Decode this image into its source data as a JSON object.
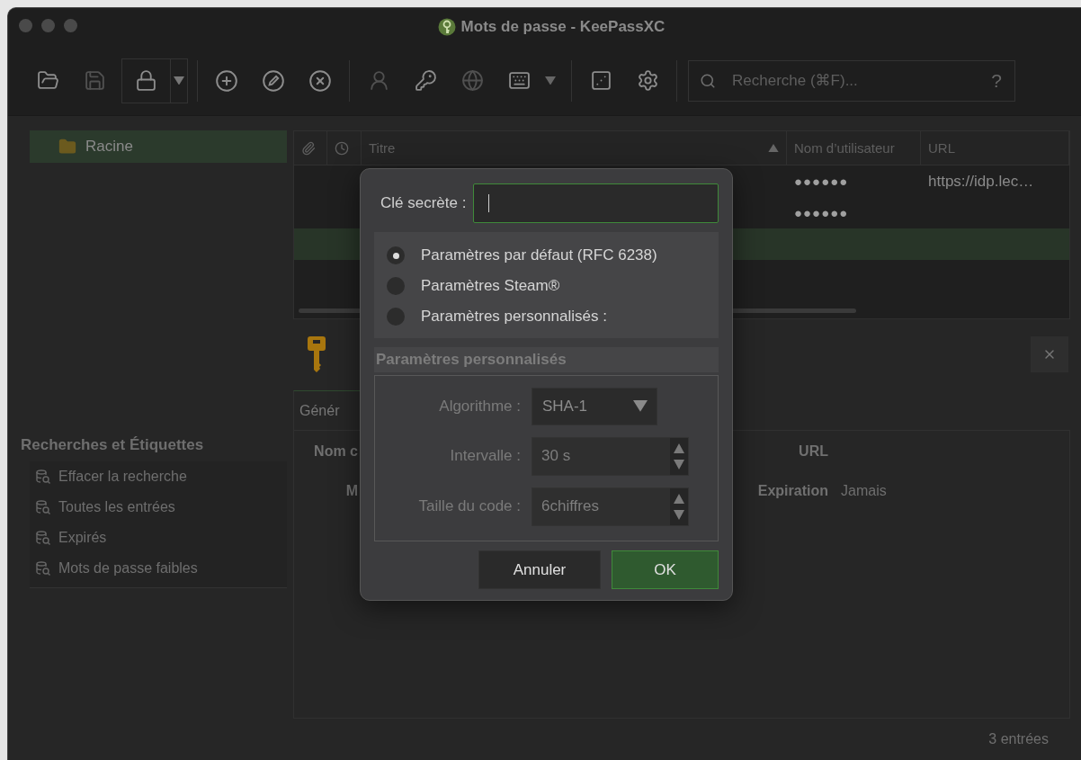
{
  "window": {
    "title": "Mots de passe - KeePassXC"
  },
  "toolbar": {
    "items": [
      {
        "kind": "open",
        "disabled": false
      },
      {
        "kind": "save",
        "disabled": true
      },
      {
        "kind": "lock",
        "disabled": false
      },
      {
        "kind": "separator"
      },
      {
        "kind": "add",
        "disabled": false
      },
      {
        "kind": "edit",
        "disabled": false
      },
      {
        "kind": "delete",
        "disabled": false
      },
      {
        "kind": "separator"
      },
      {
        "kind": "copy-user",
        "disabled": true
      },
      {
        "kind": "copy-password",
        "disabled": false
      },
      {
        "kind": "open-url",
        "disabled": true
      },
      {
        "kind": "autotype",
        "disabled": false
      },
      {
        "kind": "separator"
      },
      {
        "kind": "generator",
        "disabled": false
      },
      {
        "kind": "settings",
        "disabled": false
      },
      {
        "kind": "separator"
      }
    ],
    "search": {
      "placeholder": "Recherche (⌘F)..."
    },
    "help": "?"
  },
  "groups": [
    {
      "label": "Racine",
      "selected": true
    }
  ],
  "searches": {
    "title": "Recherches et Étiquettes",
    "items": [
      {
        "label": "Effacer la recherche"
      },
      {
        "label": "Toutes les entrées"
      },
      {
        "label": "Expirés"
      },
      {
        "label": "Mots de passe faibles"
      }
    ]
  },
  "table": {
    "columns": [
      {
        "kind": "attachment"
      },
      {
        "kind": "time"
      },
      {
        "kind": "text",
        "label": "Titre",
        "sorted": true
      },
      {
        "kind": "text",
        "label": "Nom d’utilisateur"
      },
      {
        "kind": "text",
        "label": "URL"
      }
    ],
    "rows": [
      {
        "username": "●●●●●●",
        "url": "https://idp.lec…",
        "selected": false
      },
      {
        "username": "●●●●●●",
        "selected": false
      },
      {
        "selected": true
      }
    ]
  },
  "preview": {
    "tab": "Génér",
    "fields": [
      {
        "label": "Nom c"
      },
      {
        "label": "URL"
      },
      {
        "label": "M"
      },
      {
        "label": "Expiration",
        "value": "Jamais"
      }
    ]
  },
  "status_bar": {
    "count": "3 entrées"
  },
  "dialog": {
    "secret_label": "Clé secrète :",
    "options": [
      {
        "label": "Paramètres par défaut (RFC 6238)",
        "selected": true
      },
      {
        "label": "Paramètres Steam®",
        "selected": false
      },
      {
        "label": "Paramètres personnalisés :",
        "selected": false
      }
    ],
    "custom": {
      "title": "Paramètres personnalisés",
      "disabled": true,
      "fields": [
        {
          "kind": "select",
          "label": "Algorithme :",
          "value": "SHA-1"
        },
        {
          "kind": "spin",
          "label": "Intervalle :",
          "value": "30 s"
        },
        {
          "kind": "spin",
          "label": "Taille du code :",
          "value": "6chiffres"
        }
      ]
    },
    "buttons": [
      {
        "label": "Annuler",
        "kind": "default"
      },
      {
        "label": "OK",
        "kind": "primary"
      }
    ]
  }
}
